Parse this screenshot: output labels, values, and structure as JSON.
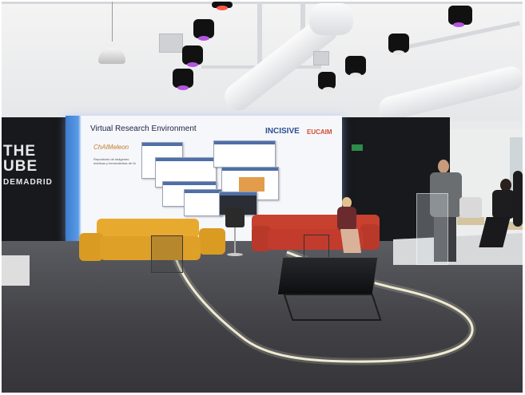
{
  "scene": {
    "description_type": "photograph",
    "venue_logo": {
      "line1": "THE",
      "line2": "UBE",
      "line3": "DEMADRID"
    },
    "screen": {
      "title": "Virtual Research Environment",
      "logo_a": "INCISIVE",
      "logo_b": "EUCAIM",
      "brand": "ChAIMeleon",
      "note": "Repositorio de imágenes médicas y herramientas de IA"
    }
  },
  "colors": {
    "screen_accent": "#3c7dd0",
    "sofa_yellow": "#e0a12a",
    "sofa_red": "#c8402e",
    "floor_light": "#f7f3d8",
    "spot_lens": "#b455e0"
  }
}
